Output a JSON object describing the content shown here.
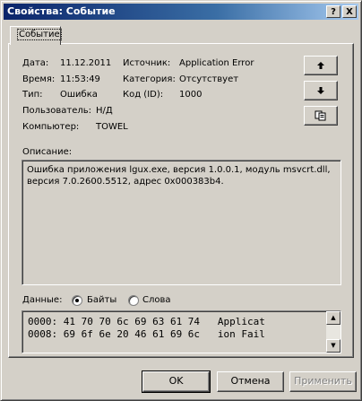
{
  "window": {
    "title": "Свойства: Событие",
    "help_glyph": "?",
    "close_glyph": "X"
  },
  "tab": {
    "label": "Событие"
  },
  "fields": {
    "date_label": "Дата:",
    "date_value": "11.12.2011",
    "time_label": "Время:",
    "time_value": "11:53:49",
    "type_label": "Тип:",
    "type_value": "Ошибка",
    "user_label": "Пользователь:",
    "user_value": "Н/Д",
    "computer_label": "Компьютер:",
    "computer_value": "TOWEL",
    "source_label": "Источник:",
    "source_value": "Application Error",
    "category_label": "Категория:",
    "category_value": "Отсутствует",
    "eventid_label": "Код (ID):",
    "eventid_value": "1000"
  },
  "side_buttons": {
    "up_icon": "arrow-up-icon",
    "down_icon": "arrow-down-icon",
    "copy_icon": "copy-icon"
  },
  "description": {
    "label": "Описание:",
    "lines": [
      "Ошибка приложения lgux.exe, версия 1.0.0.1, модуль msvcrt.dll,",
      "версия 7.0.2600.5512, адрес 0x000383b4."
    ]
  },
  "data_section": {
    "label": "Данные:",
    "bytes_option": "Байты",
    "words_option": "Слова",
    "selected": "Байты",
    "hex_lines": [
      "0000: 41 70 70 6c 69 63 61 74   Applicat",
      "0008: 69 6f 6e 20 46 61 69 6c   ion Fail"
    ]
  },
  "buttons": {
    "ok": "OK",
    "cancel": "Отмена",
    "apply": "Применить"
  }
}
